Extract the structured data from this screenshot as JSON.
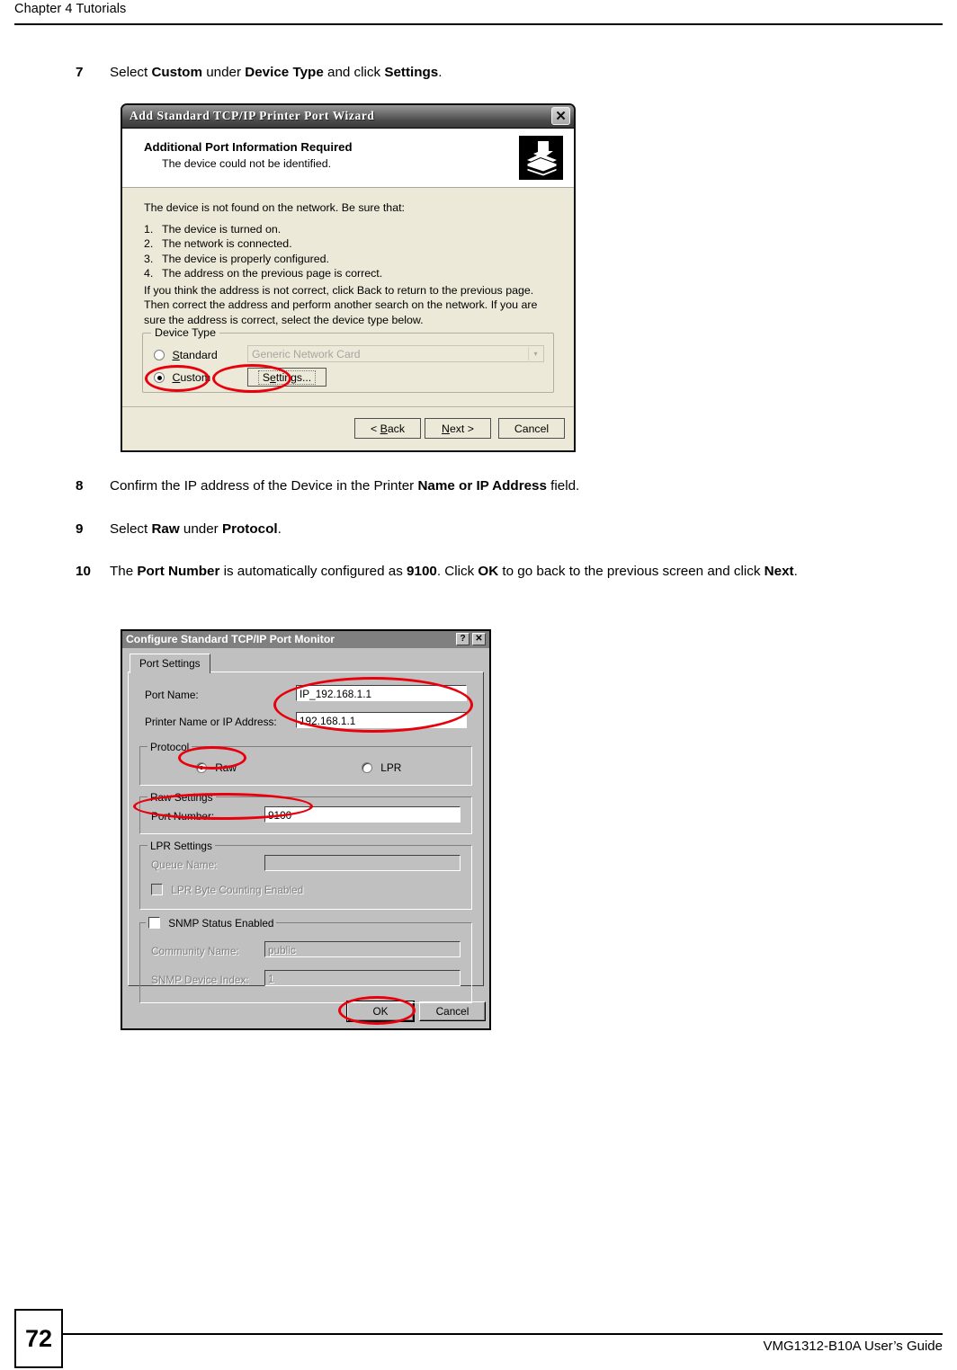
{
  "page": {
    "chapter_label": "Chapter 4 Tutorials",
    "page_number": "72",
    "guide_title": "VMG1312-B10A User’s Guide"
  },
  "steps": [
    {
      "number": "7",
      "parts": [
        {
          "t": "Select ",
          "b": false
        },
        {
          "t": "Custom",
          "b": true
        },
        {
          "t": " under ",
          "b": false
        },
        {
          "t": "Device Type",
          "b": true
        },
        {
          "t": " and click ",
          "b": false
        },
        {
          "t": "Settings",
          "b": true
        },
        {
          "t": ".",
          "b": false
        }
      ]
    },
    {
      "number": "8",
      "parts": [
        {
          "t": "Confirm the IP address of the Device in the Printer ",
          "b": false
        },
        {
          "t": "Name or IP Address",
          "b": true
        },
        {
          "t": " field.",
          "b": false
        }
      ]
    },
    {
      "number": "9",
      "parts": [
        {
          "t": "Select ",
          "b": false
        },
        {
          "t": "Raw",
          "b": true
        },
        {
          "t": " under ",
          "b": false
        },
        {
          "t": "Protocol",
          "b": true
        },
        {
          "t": ".",
          "b": false
        }
      ]
    },
    {
      "number": "10",
      "parts": [
        {
          "t": "The ",
          "b": false
        },
        {
          "t": "Port Number",
          "b": true
        },
        {
          "t": " is automatically configured as ",
          "b": false
        },
        {
          "t": "9100",
          "b": true
        },
        {
          "t": ". Click ",
          "b": false
        },
        {
          "t": "OK",
          "b": true
        },
        {
          "t": " to go back to the previous screen and click ",
          "b": false
        },
        {
          "t": "Next",
          "b": true
        },
        {
          "t": ".",
          "b": false
        }
      ]
    }
  ],
  "wizard_dialog": {
    "title": "Add Standard TCP/IP Printer Port Wizard",
    "close_label": "✕",
    "header_title": "Additional Port Information Required",
    "header_subtitle": "The device could not be identified.",
    "intro_text": "The device is not found on the network.  Be sure that:",
    "numbered_items": [
      {
        "n": "1.",
        "text": "The device is turned on."
      },
      {
        "n": "2.",
        "text": "The network is connected."
      },
      {
        "n": "3.",
        "text": "The device is properly configured."
      },
      {
        "n": "4.",
        "text": "The address on the previous page is correct."
      }
    ],
    "paragraph": "If you think the address is not correct, click Back to return to the previous page.  Then correct the address and perform another search on the network.  If you are sure the address is correct, select the device type below.",
    "group_title": "Device Type",
    "standard_label_pre": "S",
    "standard_label_rest": "tandard",
    "standard_checked": false,
    "combo_value": "Generic Network Card",
    "combo_arrow": "▾",
    "custom_label_pre": "C",
    "custom_label_rest": "ustom",
    "custom_checked": true,
    "settings_button_pre": "S",
    "settings_button_mid": "e",
    "settings_button_rest": "ttings...",
    "buttons": {
      "back_pre": "< ",
      "back_mid": "B",
      "back_rest": "ack",
      "next_pre": "",
      "next_mid": "N",
      "next_rest": "ext >",
      "cancel": "Cancel"
    }
  },
  "portmon_dialog": {
    "title": "Configure Standard TCP/IP Port Monitor",
    "help_label": "?",
    "close_label": "✕",
    "tab_label": "Port Settings",
    "port_name_label": "Port Name:",
    "port_name_value": "IP_192.168.1.1",
    "printer_name_label": "Printer Name or IP Address:",
    "printer_name_value": "192.168.1.1",
    "protocol_group_title": "Protocol",
    "raw_label": "Raw",
    "raw_checked": true,
    "lpr_label": "LPR",
    "lpr_checked": false,
    "raw_settings_group_title": "Raw Settings",
    "port_number_label": "Port Number:",
    "port_number_value": "9100",
    "lpr_settings_group_title": "LPR Settings",
    "queue_name_label": "Queue Name:",
    "queue_name_value": "",
    "lpr_byte_counting_label": "LPR Byte Counting Enabled",
    "lpr_byte_counting_checked": false,
    "snmp_status_label": "SNMP Status Enabled",
    "snmp_status_checked": false,
    "community_name_label": "Community Name:",
    "community_name_value": "public",
    "snmp_device_index_label": "SNMP Device Index:",
    "snmp_device_index_value": "1",
    "ok_label": "OK",
    "cancel_label": "Cancel"
  },
  "annotations": {
    "accent_color": "#e8000d"
  }
}
